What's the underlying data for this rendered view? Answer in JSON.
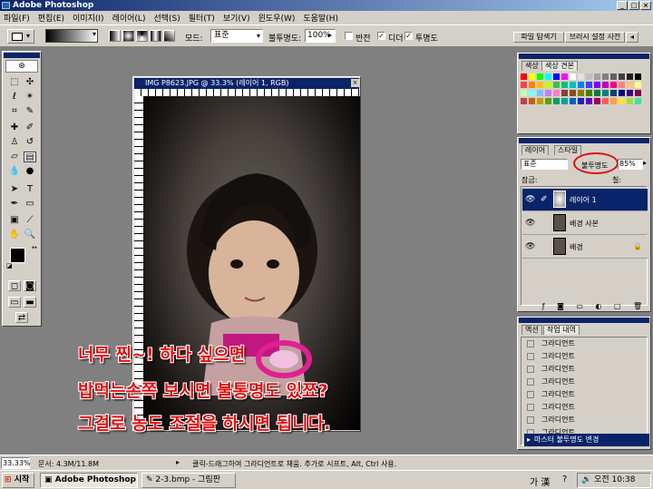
{
  "window": {
    "title": "Adobe Photoshop"
  },
  "menu": [
    "파일(F)",
    "편집(E)",
    "이미지(I)",
    "레이어(L)",
    "선택(S)",
    "필터(T)",
    "보기(V)",
    "윈도우(W)",
    "도움말(H)"
  ],
  "options": {
    "mode_label": "모드:",
    "mode_value": "표준",
    "opacity_label": "불투명도:",
    "opacity_value": "100%",
    "reverse_label": "반전",
    "dither_label": "디더",
    "transparency_label": "투명도",
    "well_tab_1": "파일 탐색기",
    "well_tab_2": "브러시 설정 사전"
  },
  "document": {
    "title": "IMG P8623.JPG @ 33.3% (레이어 1, RGB)"
  },
  "colors_panel": {
    "tab_1": "색상",
    "tab_2": "색상 견본"
  },
  "swatch_colors": [
    "#ff0000",
    "#ffff00",
    "#00ff00",
    "#00ffff",
    "#0000ff",
    "#ff00ff",
    "#ffffff",
    "#e0e0e0",
    "#c0c0c0",
    "#a0a0a0",
    "#808080",
    "#606060",
    "#404040",
    "#202020",
    "#000000",
    "#ff4040",
    "#ff8000",
    "#ffc000",
    "#c0ff00",
    "#40c040",
    "#00c080",
    "#00c0c0",
    "#0080ff",
    "#4040ff",
    "#8000ff",
    "#c000c0",
    "#ff0080",
    "#ff8080",
    "#ffc080",
    "#ffff80",
    "#c0ffc0",
    "#80ffff",
    "#80c0ff",
    "#c080ff",
    "#ff80c0",
    "#804040",
    "#805020",
    "#808000",
    "#408000",
    "#008040",
    "#008080",
    "#004080",
    "#000080",
    "#400080",
    "#800040",
    "#c04040",
    "#c06020",
    "#c0a000",
    "#60a000",
    "#00a060",
    "#00a0a0",
    "#0060c0",
    "#2020c0",
    "#6000c0",
    "#a00060",
    "#ff6060",
    "#ffa040",
    "#ffe040",
    "#a0e040",
    "#40e0a0"
  ],
  "layers_panel": {
    "tab_1": "레이어",
    "tab_2": "스타일",
    "blend_mode": "표준",
    "opacity_label": "불투명도",
    "opacity_value": "85%",
    "lock_label": "잠금:",
    "fill_label": "칠:",
    "layers": [
      {
        "name": "레이어 1"
      },
      {
        "name": "배경 사본"
      },
      {
        "name": "배경"
      }
    ]
  },
  "history_panel": {
    "tab_1": "액션",
    "tab_2": "작업 내역",
    "items": [
      "그라디언트",
      "그라디언트",
      "그라디언트",
      "그라디언트",
      "그라디언트",
      "그라디언트",
      "그라디언트",
      "그라디언트",
      "마스터 불투명도 변경"
    ]
  },
  "overlay_text": [
    "너무 찐~! 하다 싶으면",
    "밥먹는손쪽 보시면 불통명도 있쬬?",
    "그걸로 농도 조절을 하시면 됩니다."
  ],
  "status": {
    "zoom": "33.33%",
    "doc_info": "문서: 4.3M/11.8M",
    "hint": "클릭-드래그하여 그라디언트로 채움. 추가로 시프트, Alt, Ctrl 사용."
  },
  "taskbar": {
    "start": "시작",
    "tasks": [
      "Adobe Photoshop",
      "2-3.bmp - 그림판"
    ],
    "ime": "가 漢",
    "clock": "오전 10:38"
  },
  "accent": "#0a246a"
}
